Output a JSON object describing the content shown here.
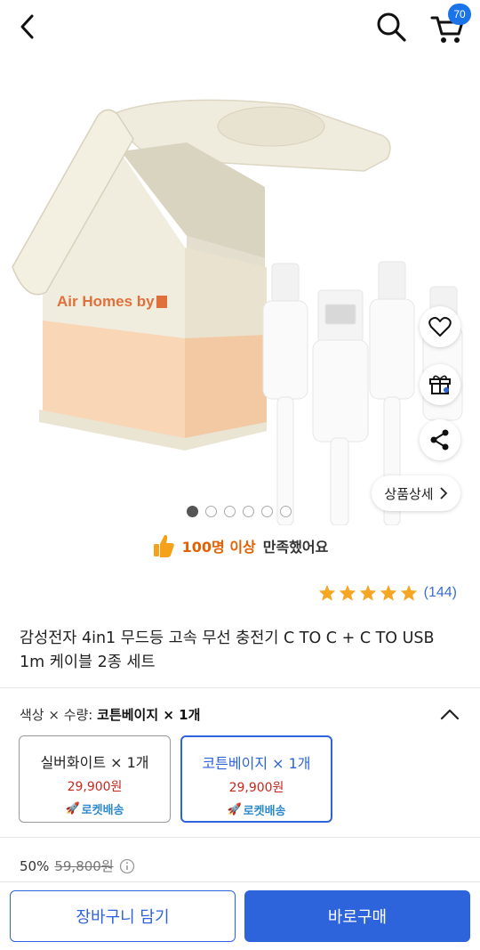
{
  "header": {
    "cart_count": "70"
  },
  "product_image": {
    "brand_text": "Air Homes by"
  },
  "gallery": {
    "dot_count": 6,
    "active_index": 0,
    "detail_label": "상품상세"
  },
  "satisfaction": {
    "highlight": "100명 이상",
    "rest": "만족했어요"
  },
  "rating": {
    "stars": 5,
    "count": "(144)"
  },
  "product": {
    "title": "감성전자 4in1 무드등 고속 무선 충전기 C TO C + C TO USB 1m 케이블 2종 세트"
  },
  "options": {
    "summary_label": "색상 × 수량:",
    "summary_value": "코튼베이지 × 1개",
    "items": [
      {
        "name": "실버화이트 × 1개",
        "price": "29,900원",
        "delivery": "로켓배송",
        "selected": false
      },
      {
        "name": "코튼베이지 × 1개",
        "price": "29,900원",
        "delivery": "로켓배송",
        "selected": true
      }
    ]
  },
  "price": {
    "discount": "50%",
    "original": "59,800원"
  },
  "actions": {
    "add_to_cart": "장바구니 담기",
    "buy_now": "바로구매"
  },
  "colors": {
    "accent": "#2d63db",
    "price_red": "#c8271e",
    "star": "#f5a623",
    "satisfaction_orange": "#e65f00"
  }
}
